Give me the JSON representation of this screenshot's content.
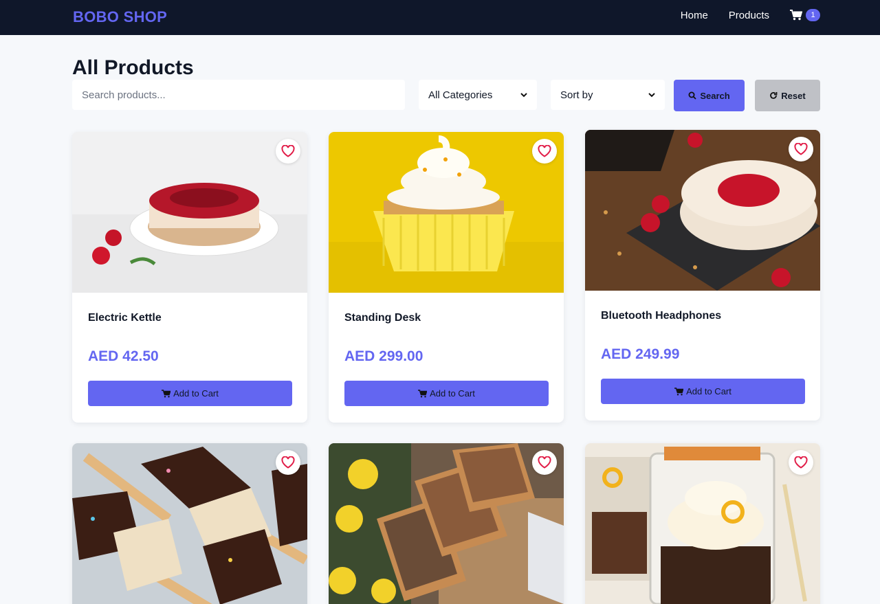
{
  "nav": {
    "brand": "BOBO SHOP",
    "links": [
      "Home",
      "Products"
    ],
    "cart_count": "1"
  },
  "page": {
    "title": "All Products"
  },
  "filters": {
    "search_placeholder": "Search products...",
    "category_selected": "All Categories",
    "sort_selected": "Sort by",
    "search_label": "Search",
    "reset_label": "Reset"
  },
  "products": [
    {
      "name": "Electric Kettle",
      "price": "AED 42.50",
      "button": "Add to Cart",
      "image": "strawberry-cheesecake"
    },
    {
      "name": "Standing Desk",
      "price": "AED 299.00",
      "button": "Add to Cart",
      "image": "yellow-cupcake"
    },
    {
      "name": "Bluetooth Headphones",
      "price": "AED 249.99",
      "button": "Add to Cart",
      "image": "strawberry-cheesecake-slate"
    },
    {
      "image": "rice-crispy-pops"
    },
    {
      "image": "lemon-loaves"
    },
    {
      "image": "cupcake-in-jar"
    }
  ],
  "colors": {
    "navbar": "#0f172a",
    "accent": "#6366f1",
    "reset_button": "#bfc1c6",
    "background": "#f6f8fb",
    "heart": "#e11d48"
  }
}
